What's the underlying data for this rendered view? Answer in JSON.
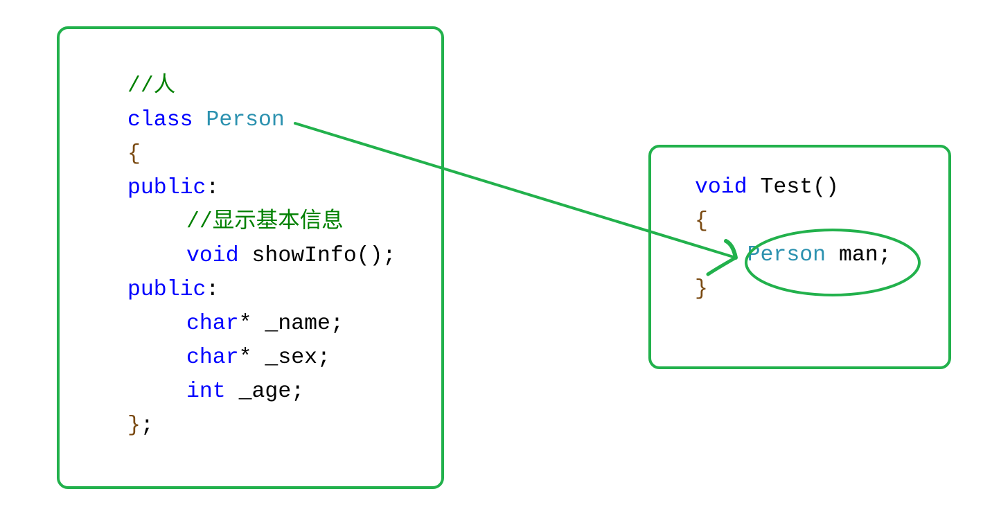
{
  "colors": {
    "box": "#22b14c",
    "keyword": "#0000ff",
    "type": "#2b91af",
    "comment": "#008000",
    "brace": "#7a4a12"
  },
  "left_code": [
    {
      "indent": false,
      "tokens": [
        {
          "t": "//人",
          "c": "comment"
        }
      ]
    },
    {
      "indent": false,
      "tokens": [
        {
          "t": "class ",
          "c": "kw"
        },
        {
          "t": "Person",
          "c": "type"
        }
      ]
    },
    {
      "indent": false,
      "tokens": [
        {
          "t": "{",
          "c": "brace"
        }
      ]
    },
    {
      "indent": false,
      "tokens": [
        {
          "t": "public",
          "c": "kw"
        },
        {
          "t": ":",
          "c": "plain"
        }
      ]
    },
    {
      "indent": true,
      "tokens": [
        {
          "t": "//显示基本信息",
          "c": "comment"
        }
      ]
    },
    {
      "indent": true,
      "tokens": [
        {
          "t": "void ",
          "c": "kw"
        },
        {
          "t": "showInfo();",
          "c": "plain"
        }
      ]
    },
    {
      "indent": false,
      "tokens": [
        {
          "t": "public",
          "c": "kw"
        },
        {
          "t": ":",
          "c": "plain"
        }
      ]
    },
    {
      "indent": true,
      "tokens": [
        {
          "t": "char",
          "c": "kw"
        },
        {
          "t": "* _name;",
          "c": "plain"
        }
      ]
    },
    {
      "indent": true,
      "tokens": [
        {
          "t": "char",
          "c": "kw"
        },
        {
          "t": "* _sex;",
          "c": "plain"
        }
      ]
    },
    {
      "indent": true,
      "tokens": [
        {
          "t": "int ",
          "c": "kw"
        },
        {
          "t": "_age;",
          "c": "plain"
        }
      ]
    },
    {
      "indent": false,
      "tokens": [
        {
          "t": "}",
          "c": "brace"
        },
        {
          "t": ";",
          "c": "plain"
        }
      ]
    }
  ],
  "right_code": [
    {
      "indent": false,
      "tokens": [
        {
          "t": "void ",
          "c": "kw"
        },
        {
          "t": "Test()",
          "c": "plain"
        }
      ]
    },
    {
      "indent": false,
      "tokens": [
        {
          "t": "{",
          "c": "brace"
        }
      ]
    },
    {
      "indent": false,
      "tokens": [
        {
          "t": "    ",
          "c": "plain"
        },
        {
          "t": "Person",
          "c": "type"
        },
        {
          "t": " man;",
          "c": "plain"
        }
      ]
    },
    {
      "indent": false,
      "tokens": [
        {
          "t": "}",
          "c": "brace"
        }
      ]
    }
  ]
}
